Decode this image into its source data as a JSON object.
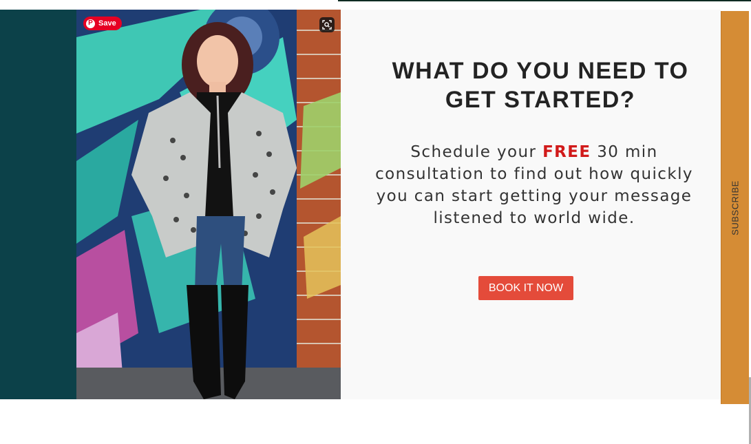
{
  "pin_save": {
    "label": "Save",
    "icon": "pinterest-icon"
  },
  "photo": {
    "icon": "visual-search-icon"
  },
  "hero": {
    "headline": "WHAT DO YOU NEED TO GET STARTED?",
    "body_before": "Schedule your ",
    "body_emphasis": "FREE",
    "body_after": " 30 min consultation to find out how quickly you can start getting your message listened to world wide.",
    "cta_label": "BOOK IT NOW"
  },
  "side_tab": {
    "label": "SUBSCRIBE"
  },
  "colors": {
    "teal_panel": "#0c4149",
    "cta": "#e44b3a",
    "emphasis": "#d11a1a",
    "subscribe_tab": "#d58c35",
    "pinterest": "#e60023"
  }
}
